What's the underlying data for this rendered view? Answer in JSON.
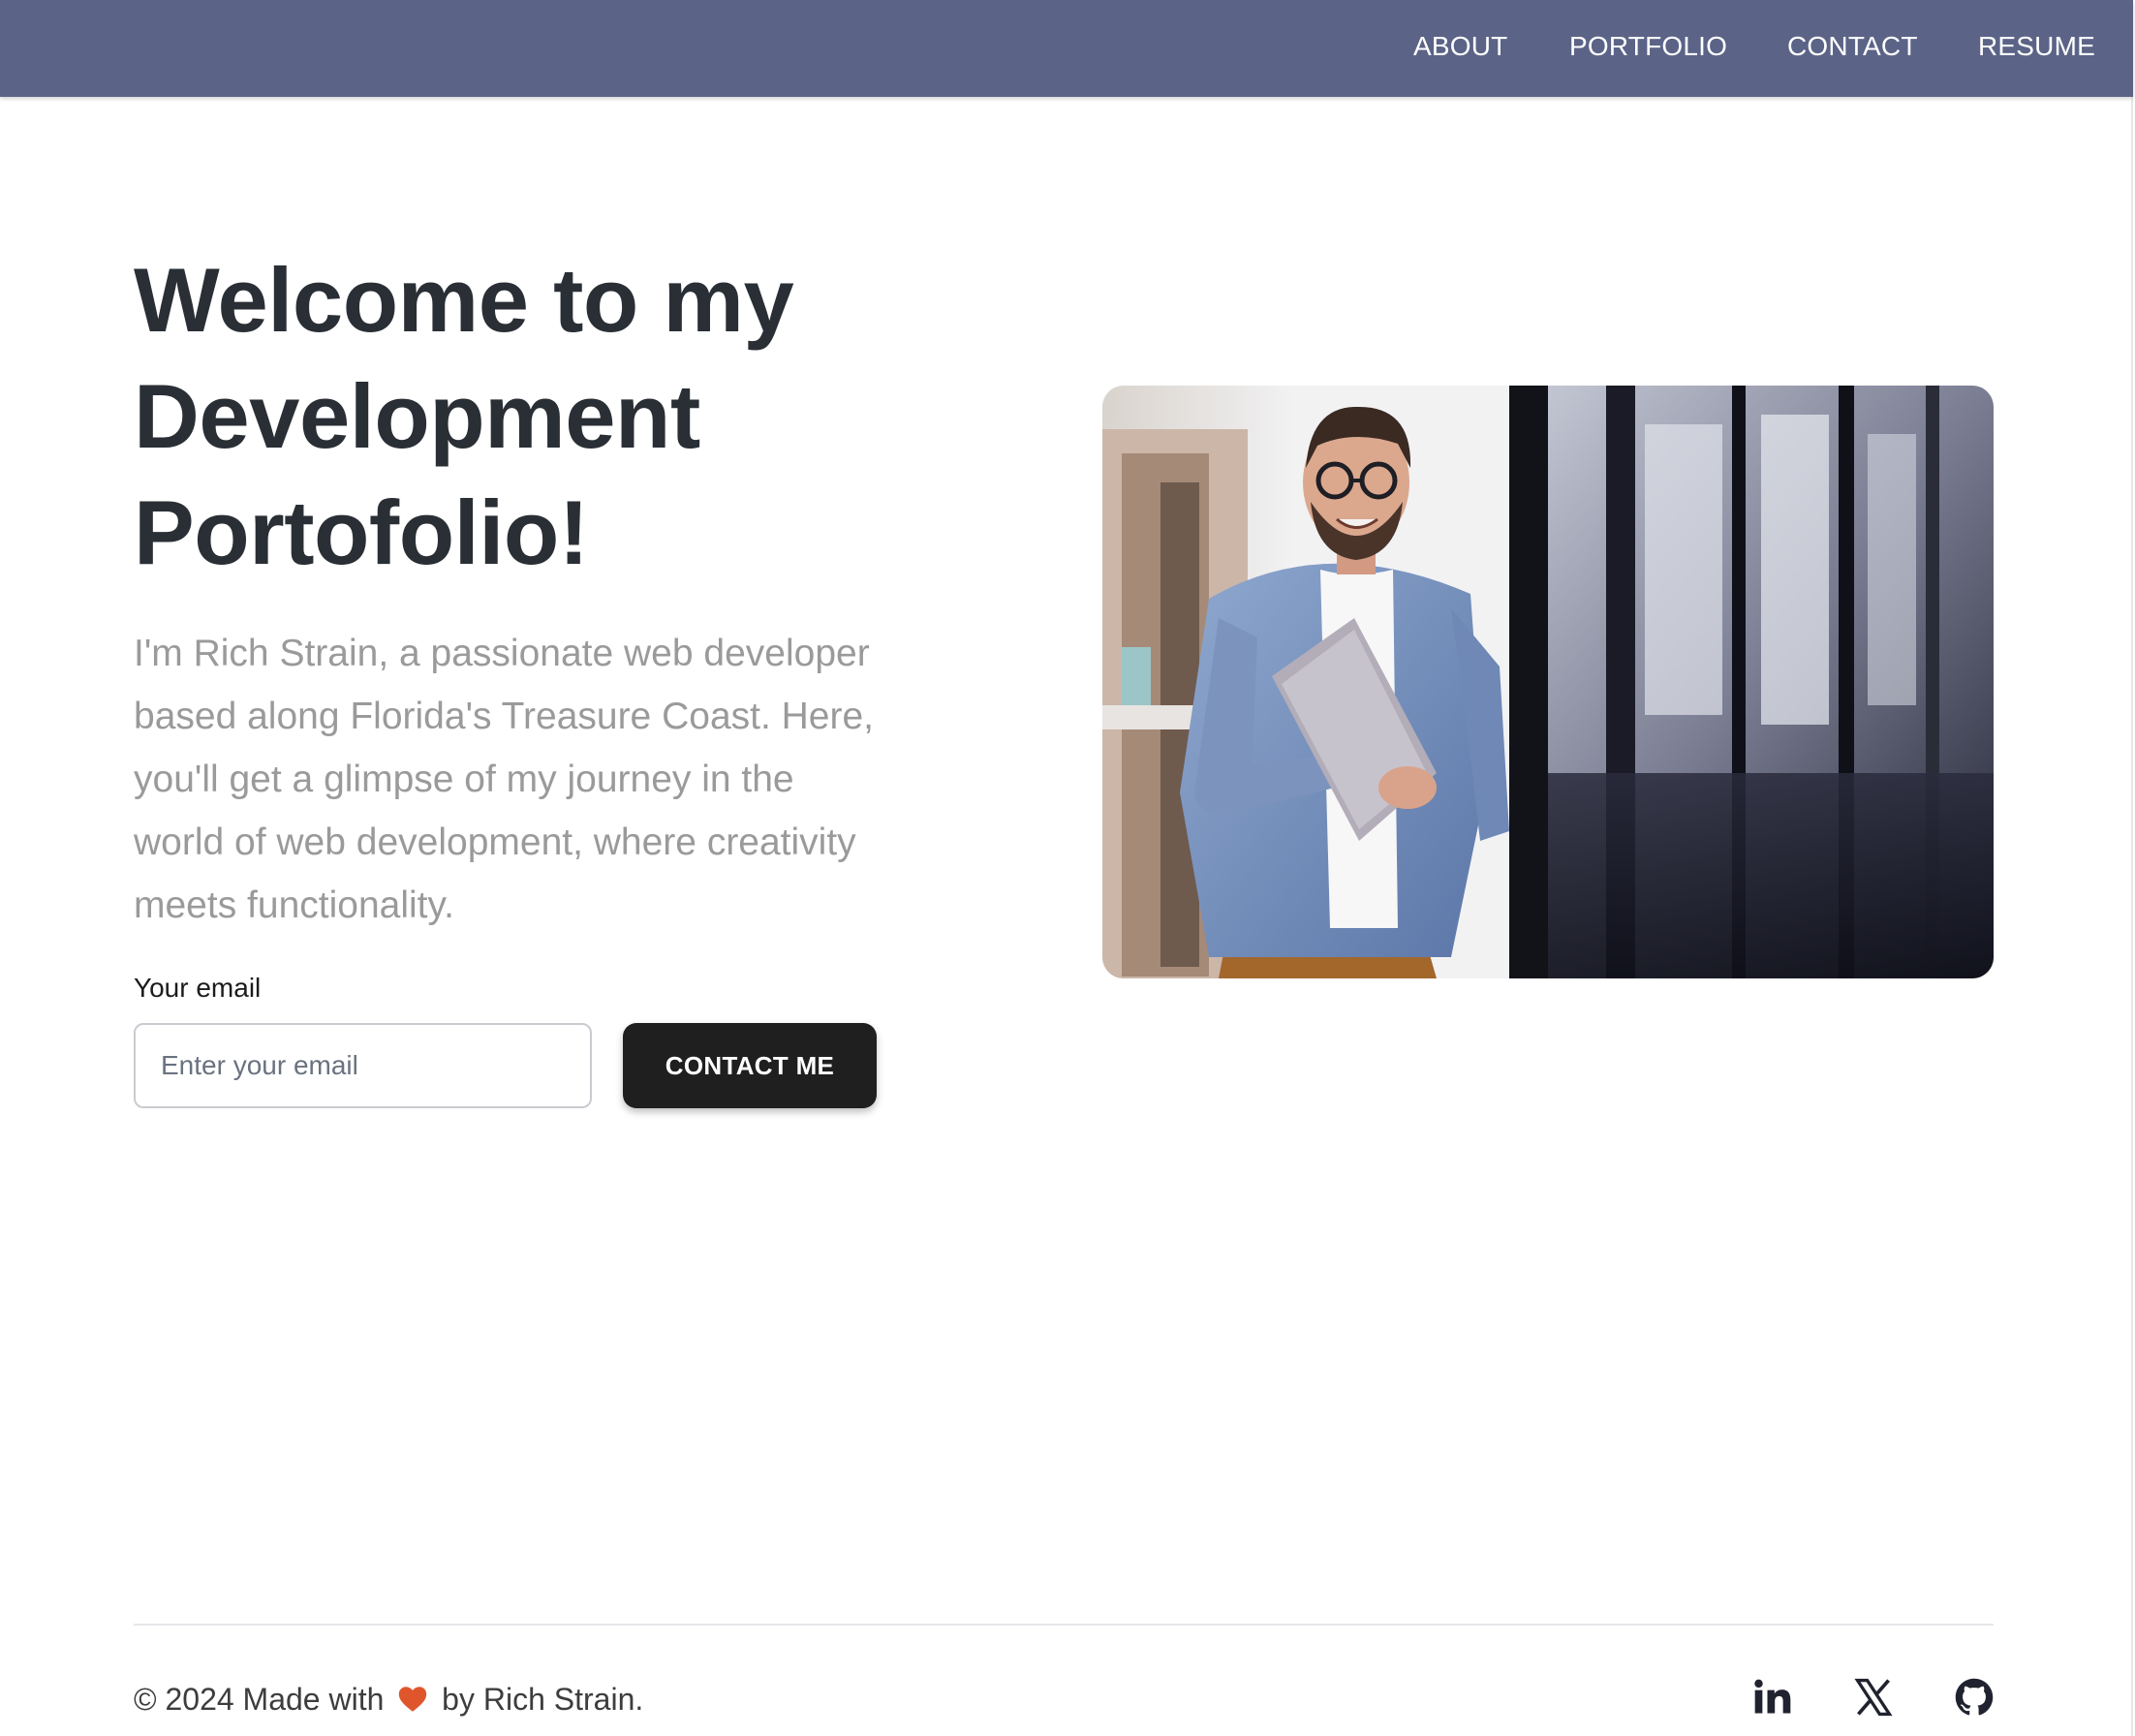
{
  "nav": {
    "items": [
      "ABOUT",
      "PORTFOLIO",
      "CONTACT",
      "RESUME"
    ]
  },
  "hero": {
    "title_lines": [
      "Welcome to my",
      "Development",
      "Portofolio!"
    ],
    "body_lines": [
      "I'm Rich Strain, a passionate web developer",
      "based along Florida's Treasure Coast. Here,",
      "you'll get a glimpse of my journey in the",
      "world of web development, where creativity",
      "meets functionality."
    ]
  },
  "form": {
    "email_label": "Your email",
    "email_placeholder": "Enter your email",
    "email_value": "",
    "button_label": "CONTACT ME"
  },
  "footer": {
    "copyright_prefix": "© 2024 Made with",
    "copyright_suffix": "by Rich Strain.",
    "heart_icon": "heart-icon",
    "social_icons": [
      "linkedin-icon",
      "x-icon",
      "github-icon"
    ]
  },
  "colors": {
    "navbar": "#5b6387",
    "title": "#2a2f36",
    "body_text": "#9a9a9a",
    "button": "#1f1f1f",
    "heart": "#e0562c"
  }
}
